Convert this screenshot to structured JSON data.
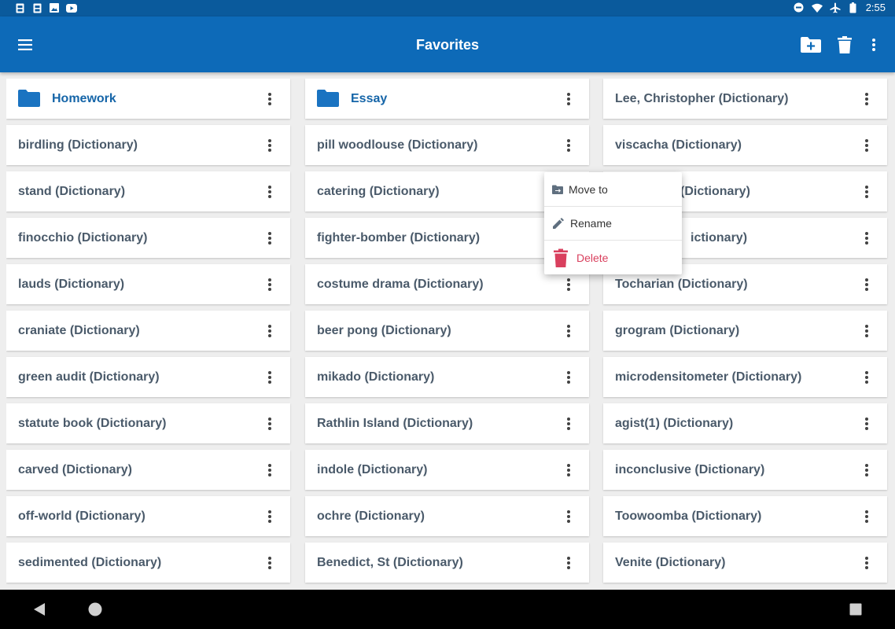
{
  "status_bar": {
    "time": "2:55",
    "left_icons": [
      "sim-icon",
      "sim-icon",
      "image-icon",
      "youtube-icon"
    ],
    "right_icons": [
      "dnd-icon",
      "wifi-icon",
      "airplane-icon",
      "battery-icon"
    ]
  },
  "app_bar": {
    "title": "Favorites",
    "menu_icon": "hamburger-menu-icon",
    "actions": [
      "new-folder-icon",
      "delete-icon",
      "more-vert-icon"
    ]
  },
  "columns": [
    {
      "items": [
        {
          "label": "Homework",
          "type": "folder"
        },
        {
          "label": "birdling (Dictionary)",
          "type": "entry"
        },
        {
          "label": "stand (Dictionary)",
          "type": "entry"
        },
        {
          "label": "finocchio (Dictionary)",
          "type": "entry"
        },
        {
          "label": "lauds (Dictionary)",
          "type": "entry"
        },
        {
          "label": "craniate (Dictionary)",
          "type": "entry"
        },
        {
          "label": "green audit (Dictionary)",
          "type": "entry"
        },
        {
          "label": "statute book (Dictionary)",
          "type": "entry"
        },
        {
          "label": "carved (Dictionary)",
          "type": "entry"
        },
        {
          "label": "off-world (Dictionary)",
          "type": "entry"
        },
        {
          "label": "sedimented (Dictionary)",
          "type": "entry"
        }
      ]
    },
    {
      "items": [
        {
          "label": "Essay",
          "type": "folder"
        },
        {
          "label": "pill woodlouse (Dictionary)",
          "type": "entry"
        },
        {
          "label": "catering (Dictionary)",
          "type": "entry"
        },
        {
          "label": "fighter-bomber (Dictionary)",
          "type": "entry"
        },
        {
          "label": "costume drama (Dictionary)",
          "type": "entry"
        },
        {
          "label": "beer pong (Dictionary)",
          "type": "entry"
        },
        {
          "label": "mikado (Dictionary)",
          "type": "entry"
        },
        {
          "label": "Rathlin Island (Dictionary)",
          "type": "entry"
        },
        {
          "label": "indole (Dictionary)",
          "type": "entry"
        },
        {
          "label": "ochre (Dictionary)",
          "type": "entry"
        },
        {
          "label": "Benedict, St (Dictionary)",
          "type": "entry"
        }
      ]
    },
    {
      "items": [
        {
          "label": "Lee, Christopher (Dictionary)",
          "type": "entry"
        },
        {
          "label": "viscacha (Dictionary)",
          "type": "entry"
        },
        {
          "label": "(Dictionary)",
          "type": "entry"
        },
        {
          "label": "ictionary)",
          "type": "entry"
        },
        {
          "label": "Tocharian (Dictionary)",
          "type": "entry"
        },
        {
          "label": "grogram (Dictionary)",
          "type": "entry"
        },
        {
          "label": "microdensitometer (Dictionary)",
          "type": "entry"
        },
        {
          "label": "agist(1) (Dictionary)",
          "type": "entry"
        },
        {
          "label": "inconclusive (Dictionary)",
          "type": "entry"
        },
        {
          "label": "Toowoomba (Dictionary)",
          "type": "entry"
        },
        {
          "label": "Venite (Dictionary)",
          "type": "entry"
        }
      ]
    }
  ],
  "context_menu": {
    "items": [
      {
        "label": "Move to",
        "icon": "move-to-folder-icon"
      },
      {
        "label": "Rename",
        "icon": "pencil-icon"
      },
      {
        "label": "Delete",
        "icon": "trash-icon"
      }
    ],
    "colors": {
      "delete": "#d9405e",
      "text": "#333333"
    }
  },
  "nav_bar": {
    "buttons": [
      "back-icon",
      "home-icon",
      "recents-icon"
    ]
  },
  "colors": {
    "app_bar": "#0d6ab8",
    "status_bar": "#0a5a9c",
    "folder": "#1a73c1",
    "folder_text": "#1565a8",
    "entry_text": "#4a5a6a"
  }
}
